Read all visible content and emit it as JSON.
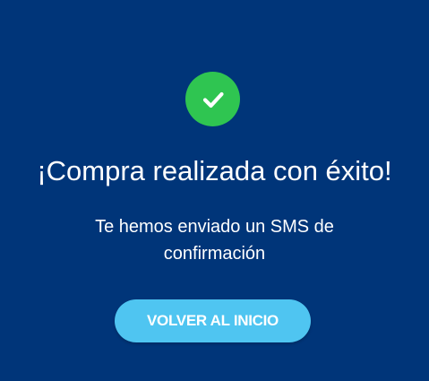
{
  "colors": {
    "background": "#003579",
    "success_green": "#2fc551",
    "button_blue": "#4fc5f1",
    "text": "#ffffff"
  },
  "success": {
    "icon": "check-icon",
    "title": "¡Compra realizada con éxito!",
    "message": "Te hemos enviado un SMS de confirmación"
  },
  "actions": {
    "home_label": "VOLVER AL INICIO"
  }
}
